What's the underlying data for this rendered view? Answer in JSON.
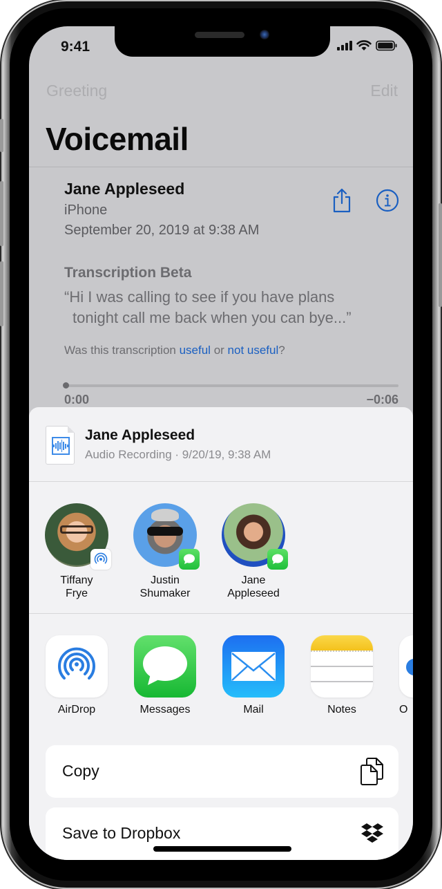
{
  "status_bar": {
    "time": "9:41"
  },
  "voicemail": {
    "nav": {
      "left": "Greeting",
      "right": "Edit"
    },
    "title": "Voicemail",
    "detail": {
      "caller": "Jane Appleseed",
      "device": "iPhone",
      "date": "September 20, 2019 at 9:38 AM",
      "actions": {
        "share_icon": "share-icon",
        "info_icon": "info-icon"
      }
    },
    "transcription": {
      "title": "Transcription Beta",
      "line1": "“Hi I was calling to see if you have plans",
      "line2": "tonight call me back when you can bye...”",
      "feedback_prefix": "Was this transcription ",
      "feedback_useful": "useful",
      "feedback_or": " or ",
      "feedback_not_useful": "not useful",
      "feedback_suffix": "?"
    },
    "playback": {
      "elapsed": "0:00",
      "remaining": "−0:06",
      "progress_fraction": 0.0
    }
  },
  "share_sheet": {
    "header": {
      "title": "Jane Appleseed",
      "subtitle": "Audio Recording · 9/20/19, 9:38 AM",
      "icon": "audio-file-icon"
    },
    "people": [
      {
        "first": "Tiffany",
        "last": "Frye",
        "badge": "airdrop"
      },
      {
        "first": "Justin",
        "last": "Shumaker",
        "badge": "messages"
      },
      {
        "first": "Jane",
        "last": "Appleseed",
        "badge": "messages"
      }
    ],
    "apps": [
      {
        "label": "AirDrop",
        "icon": "airdrop-icon"
      },
      {
        "label": "Messages",
        "icon": "messages-icon"
      },
      {
        "label": "Mail",
        "icon": "mail-icon"
      },
      {
        "label": "Notes",
        "icon": "notes-icon"
      },
      {
        "label": "O",
        "icon": "partial-app-icon"
      }
    ],
    "actions": [
      {
        "label": "Copy",
        "icon": "copy-icon"
      },
      {
        "label": "Save to Dropbox",
        "icon": "dropbox-icon"
      }
    ]
  },
  "colors": {
    "accent_blue": "#1a5fc1",
    "messages_green": "#30c94a",
    "mail_blue": "#1f8ff0",
    "notes_yellow": "#f8cf2c"
  }
}
